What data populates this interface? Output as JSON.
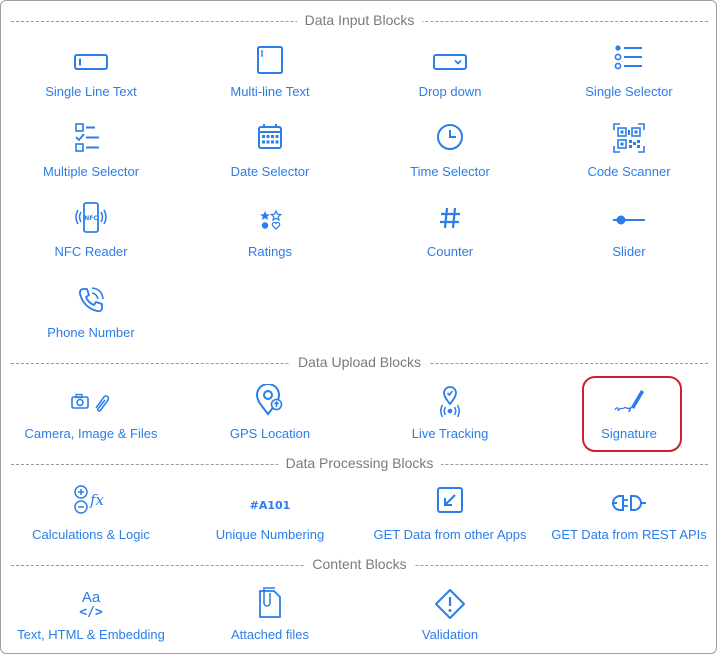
{
  "colors": {
    "accent": "#2b7de9",
    "section_title": "#7a7a7a",
    "highlight": "#d01f2c"
  },
  "sections": {
    "input": {
      "title": "Data Input Blocks",
      "items": [
        {
          "label": "Single Line Text",
          "icon": "single-line-text-icon"
        },
        {
          "label": "Multi-line Text",
          "icon": "multi-line-text-icon"
        },
        {
          "label": "Drop down",
          "icon": "dropdown-icon"
        },
        {
          "label": "Single Selector",
          "icon": "radio-list-icon"
        },
        {
          "label": "Multiple Selector",
          "icon": "checkbox-list-icon"
        },
        {
          "label": "Date Selector",
          "icon": "calendar-icon"
        },
        {
          "label": "Time Selector",
          "icon": "clock-icon"
        },
        {
          "label": "Code Scanner",
          "icon": "qr-code-icon"
        },
        {
          "label": "NFC Reader",
          "icon": "nfc-phone-icon"
        },
        {
          "label": "Ratings",
          "icon": "ratings-icon"
        },
        {
          "label": "Counter",
          "icon": "hash-icon"
        },
        {
          "label": "Slider",
          "icon": "slider-icon"
        },
        {
          "label": "Phone Number",
          "icon": "phone-icon"
        }
      ]
    },
    "upload": {
      "title": "Data Upload Blocks",
      "items": [
        {
          "label": "Camera, Image & Files",
          "icon": "camera-attach-icon"
        },
        {
          "label": "GPS Location",
          "icon": "map-pin-icon"
        },
        {
          "label": "Live Tracking",
          "icon": "live-tracking-icon"
        },
        {
          "label": "Signature",
          "icon": "signature-pen-icon"
        }
      ]
    },
    "processing": {
      "title": "Data Processing Blocks",
      "items": [
        {
          "label": "Calculations & Logic",
          "icon": "calculation-fx-icon"
        },
        {
          "label": "Unique Numbering",
          "icon": "unique-number-icon",
          "icon_text": "#A101"
        },
        {
          "label": "GET Data from other Apps",
          "icon": "import-arrow-icon"
        },
        {
          "label": "GET Data from REST APIs",
          "icon": "plug-connector-icon"
        }
      ]
    },
    "content": {
      "title": "Content Blocks",
      "items": [
        {
          "label": "Text, HTML & Embedding",
          "icon": "text-code-icon",
          "icon_text": "Aa",
          "icon_code": "</>"
        },
        {
          "label": "Attached files",
          "icon": "attached-files-icon"
        },
        {
          "label": "Validation",
          "icon": "warning-diamond-icon"
        }
      ]
    }
  }
}
